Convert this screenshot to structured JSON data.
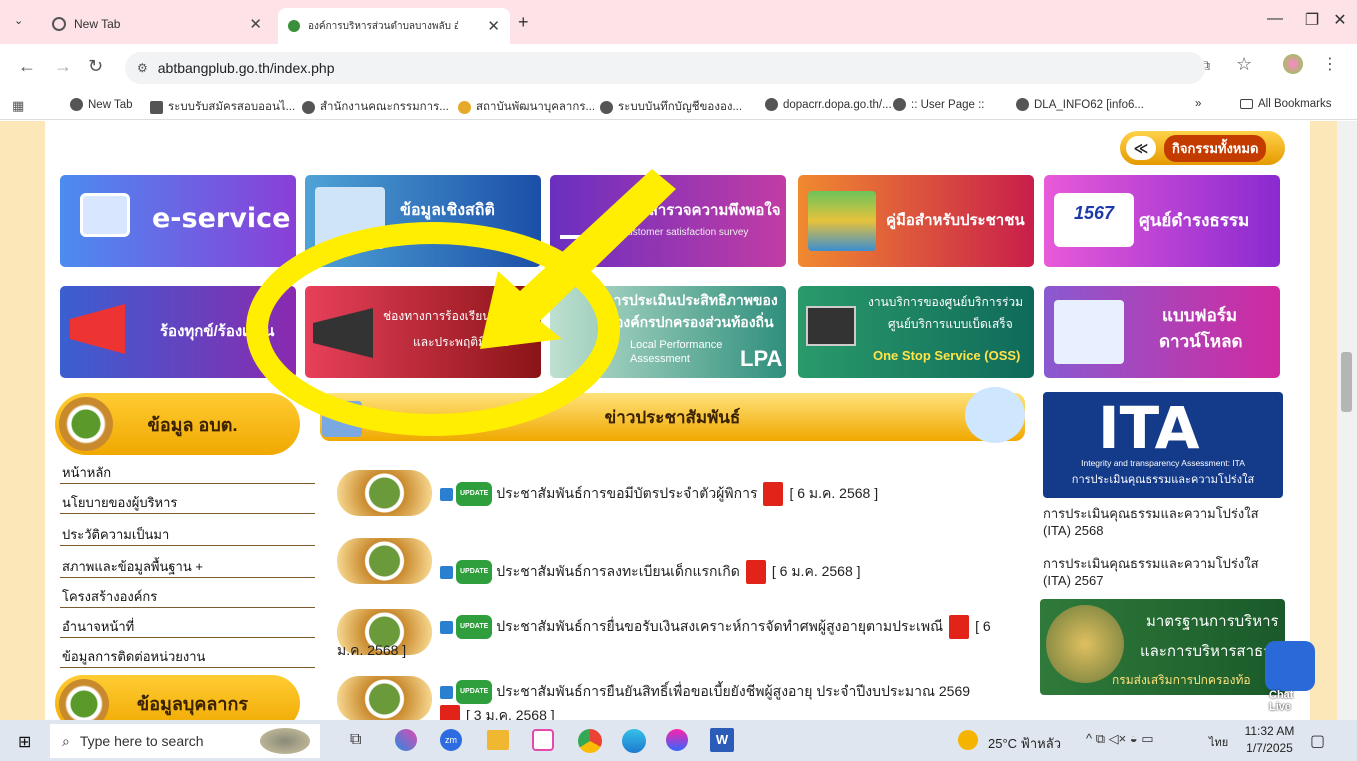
{
  "browser": {
    "tabs": [
      {
        "label": "New Tab"
      },
      {
        "label": "องค์การบริหารส่วนตำบลบางพลับ อำเ"
      }
    ],
    "url": "abtbangplub.go.th/index.php",
    "bookmarks": [
      "New Tab",
      "ระบบรับสมัครสอบออนไ...",
      "สำนักงานคณะกรรมการ...",
      "สถาบันพัฒนาบุคลากร...",
      "ระบบบันทึกบัญชีขององ...",
      "dopacrr.dopa.go.th/...",
      ":: User Page ::",
      "DLA_INFO62 [info6..."
    ],
    "bookmarks_more": "»",
    "all_bookmarks": "All Bookmarks"
  },
  "page": {
    "activities_all": "กิจกรรมทั้งหมด",
    "tiles_row1": [
      {
        "title": "e-service",
        "color": "#7b3fd6"
      },
      {
        "title": "ข้อมูลเชิงสถิติ",
        "color": "#1f5fb5"
      },
      {
        "title": "แบบสำรวจความพึงพอใจ",
        "sub": "Customer satisfaction survey",
        "color": "#9b2aa6"
      },
      {
        "title": "คู่มือสำหรับประชาชน",
        "color": "#d0303a"
      },
      {
        "title": "ศูนย์ดำรงธรรม",
        "logo": "1567",
        "color": "#c33cc8"
      }
    ],
    "tiles_row2": [
      {
        "title": "ร้องทุกข์/ร้องเรียน",
        "color": "#5c3fb2"
      },
      {
        "title": "ช่องทางการร้องเรียนทุจริต",
        "title2": "และประพฤติมิชอบ",
        "color": "#b1202a"
      },
      {
        "title": "การประเมินประสิทธิภาพของ",
        "title2": "องค์กรปกครองส่วนท้องถิ่น",
        "sub": "Local Performance Assessment",
        "big": "LPA",
        "color": "#2f8f7c"
      },
      {
        "title": "งานบริการของศูนย์บริการร่วม",
        "title2": "ศูนย์บริการแบบเบ็ดเสร็จ",
        "sub": "One Stop Service (OSS)",
        "color": "#1b8a6a"
      },
      {
        "title": "แบบฟอร์ม",
        "title2": "ดาวน์โหลด",
        "color": "#b02ab5"
      }
    ],
    "sidebar": {
      "header": "ข้อมูล อบต.",
      "items": [
        "หน้าหลัก",
        "นโยบายของผู้บริหาร",
        "ประวัติความเป็นมา",
        "สภาพและข้อมูลพื้นฐาน +",
        "โครงสร้างองค์กร",
        "อำนาจหน้าที่",
        "ข้อมูลการติดต่อหน่วยงาน"
      ],
      "header2": "ข้อมูลบุคลากร"
    },
    "news": {
      "header": "ข่าวประชาสัมพันธ์",
      "badge": "UPDATE",
      "items": [
        {
          "text": "ประชาสัมพันธ์การขอมีบัตรประจำตัวผู้พิการ",
          "date": "[ 6 ม.ค. 2568 ]"
        },
        {
          "text": "ประชาสัมพันธ์การลงทะเบียนเด็กแรกเกิด",
          "date": "[ 6 ม.ค. 2568 ]"
        },
        {
          "text": "ประชาสัมพันธ์การยื่นขอรับเงินสงเคราะห์การจัดทำศพผู้สูงอายุตามประเพณี",
          "date": "[ 6",
          "date2": "ม.ค. 2568 ]"
        },
        {
          "text": "ประชาสัมพันธ์การยืนยันสิทธิ์เพื่อขอเบี้ยยังชีพผู้สูงอายุ ประจำปีงบประมาณ 2569",
          "date": "[ 3 ม.ค. 2568 ]"
        }
      ]
    },
    "ita": {
      "logo": "ITA",
      "caption1": "Integrity and transparency Assessment: ITA",
      "caption2": "การประเมินคุณธรรมและความโปร่งใส",
      "links": [
        "การประเมินคุณธรรมและความโปร่งใส (ITA) 2568",
        "การประเมินคุณธรรมและความโปร่งใส (ITA) 2567"
      ],
      "banner_line1": "มาตรฐานการบริหาร",
      "banner_line2": "และการบริหารสาธารณ",
      "banner_line3": "กรมส่งเสริมการปกครองท้อ"
    },
    "chat": "Chat Live"
  },
  "annotation": {
    "highlight": "yellow-circle-and-arrow"
  },
  "taskbar": {
    "search_placeholder": "Type here to search",
    "weather": "25°C ฟ้าหลัว",
    "lang": "ไทย",
    "time": "11:32 AM",
    "date": "1/7/2025"
  }
}
